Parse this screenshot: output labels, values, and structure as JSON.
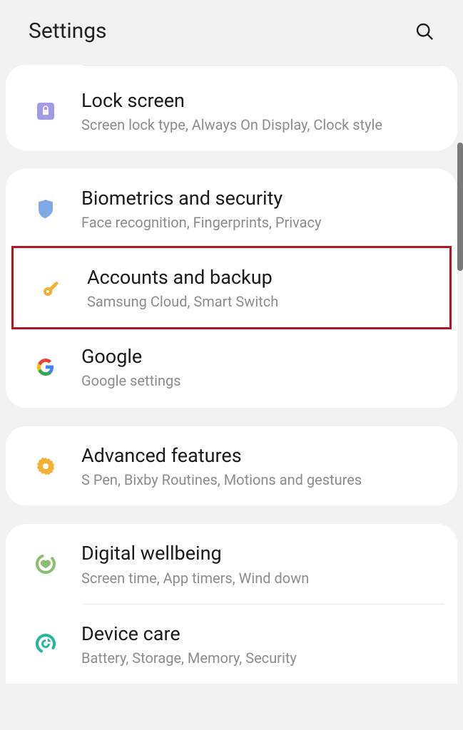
{
  "header": {
    "title": "Settings"
  },
  "groups": [
    {
      "items": [
        {
          "icon": "lock-icon",
          "title": "Lock screen",
          "sub": "Screen lock type, Always On Display, Clock style"
        }
      ]
    },
    {
      "items": [
        {
          "icon": "shield-icon",
          "title": "Biometrics and security",
          "sub": "Face recognition, Fingerprints, Privacy"
        },
        {
          "icon": "key-icon",
          "title": "Accounts and backup",
          "sub": "Samsung Cloud, Smart Switch",
          "highlighted": true
        },
        {
          "icon": "google-icon",
          "title": "Google",
          "sub": "Google settings"
        }
      ]
    },
    {
      "items": [
        {
          "icon": "gear-icon",
          "title": "Advanced features",
          "sub": "S Pen, Bixby Routines, Motions and gestures"
        }
      ]
    },
    {
      "items": [
        {
          "icon": "wellbeing-icon",
          "title": "Digital wellbeing",
          "sub": "Screen time, App timers, Wind down"
        },
        {
          "icon": "devicecare-icon",
          "title": "Device care",
          "sub": "Battery, Storage, Memory, Security"
        }
      ]
    }
  ]
}
